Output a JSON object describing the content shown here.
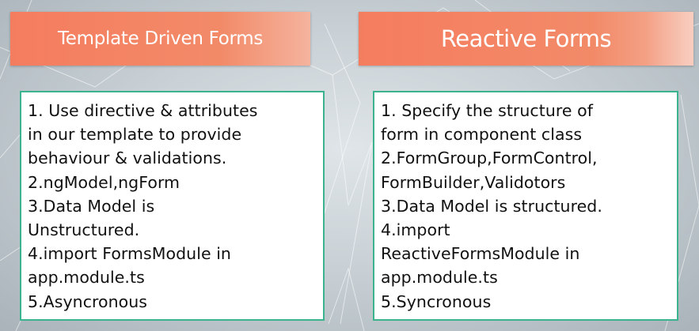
{
  "left_panel": {
    "title": "Template Driven Forms",
    "lines": [
      "1. Use directive & attributes",
      "in our template to provide",
      "behaviour & validations.",
      "2.ngModel,ngForm",
      "3.Data Model is",
      "Unstructured.",
      "4.import FormsModule in",
      "app.module.ts",
      "5.Asyncronous"
    ]
  },
  "right_panel": {
    "title": "Reactive Forms",
    "lines": [
      "1. Specify the structure of",
      "form in component class",
      "2.FormGroup,FormControl,",
      "FormBuilder,Validotors",
      "3.Data Model is structured.",
      "4.import",
      "ReactiveFormsModule in",
      "app.module.ts",
      "5.Syncronous"
    ]
  },
  "colors": {
    "header": "#f57d5f",
    "card_border": "#3bb38e",
    "background": "#c9d1d6"
  }
}
